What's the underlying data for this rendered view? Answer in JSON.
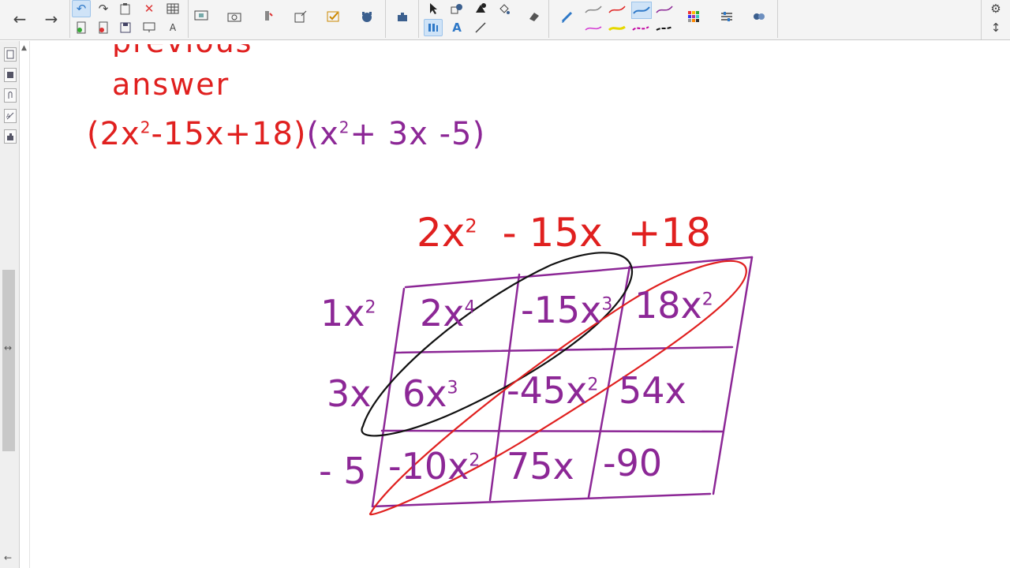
{
  "toolbar": {
    "icons": [
      "arrow-left-icon",
      "arrow-right-icon",
      "undo-icon",
      "redo-icon",
      "paste-icon",
      "delete-icon",
      "table-icon",
      "screen-shade-icon",
      "camera-icon",
      "highlight-icon",
      "insert-icon",
      "check-icon",
      "activity-icon",
      "addon-icon",
      "select-icon",
      "shapes-icon",
      "fill-icon",
      "eraser-icon",
      "pen-icon",
      "text-icon",
      "line-icon",
      "color-grid-icon",
      "properties-icon",
      "link-icon",
      "gear-icon",
      "expand-icon"
    ],
    "glyphs": {
      "back": "←",
      "forward": "→",
      "undo": "↶",
      "redo": "↷",
      "delete": "✕",
      "text": "A",
      "gear": "⚙",
      "expand": "↕"
    },
    "accent": "#2e78c7"
  },
  "sidebar": {
    "collapse_arrow": "↔",
    "down_arrow": "←"
  },
  "canvas": {
    "line1": "previous",
    "line2": "answer",
    "expression": {
      "open1": "(2x",
      "exp1": "2",
      "rest1": "-15x+18)",
      "open2": "(x",
      "exp2": "2",
      "rest2": "+ 3x -5)"
    },
    "top_factor": {
      "t1": "2x",
      "e1": "2",
      "t2": "- 15x",
      "t3": "+18"
    },
    "left_factor": [
      {
        "text": "1x",
        "exp": "2"
      },
      {
        "text": "3x",
        "exp": ""
      },
      {
        "text": "- 5",
        "exp": ""
      }
    ],
    "cells": [
      [
        {
          "base": "2x",
          "exp": "4"
        },
        {
          "base": "-15x",
          "exp": "3"
        },
        {
          "base": "18x",
          "exp": "2"
        }
      ],
      [
        {
          "base": "6x",
          "exp": "3"
        },
        {
          "base": "-45x",
          "exp": "2"
        },
        {
          "base": "54x",
          "exp": ""
        }
      ],
      [
        {
          "base": "-10x",
          "exp": "2"
        },
        {
          "base": "75x",
          "exp": ""
        },
        {
          "base": "-90",
          "exp": ""
        }
      ]
    ],
    "colors": {
      "red": "#e0201f",
      "purple": "#8c2796",
      "black": "#111111"
    }
  }
}
